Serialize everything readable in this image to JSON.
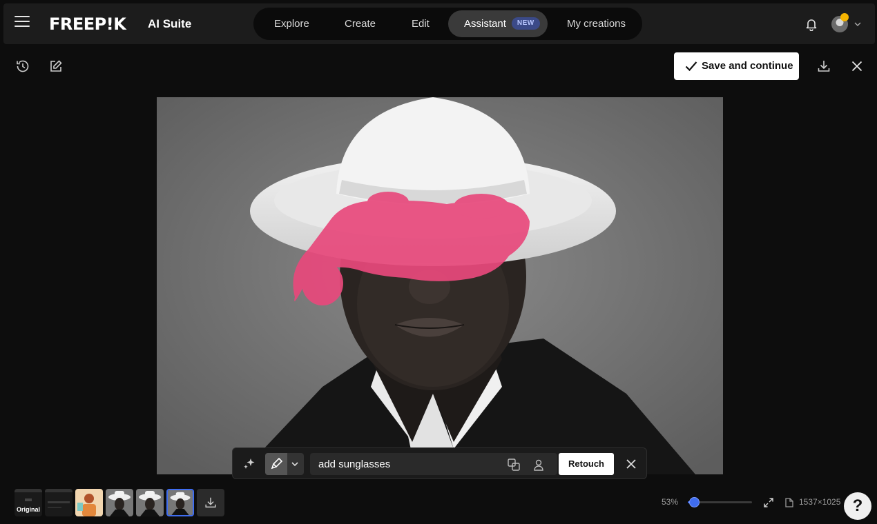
{
  "header": {
    "logo": "FREEP!K",
    "suite": "AI Suite",
    "nav": [
      {
        "label": "Explore"
      },
      {
        "label": "Create"
      },
      {
        "label": "Edit"
      },
      {
        "label": "Assistant",
        "badge": "NEW"
      },
      {
        "label": "My creations"
      }
    ],
    "active_nav": "Assistant",
    "icons": [
      "menu-icon",
      "bell-icon",
      "avatar",
      "chevron-down-icon"
    ]
  },
  "toolbar": {
    "save_label": "Save and continue",
    "icons": [
      "history-icon",
      "edit-icon",
      "download-icon",
      "close-icon"
    ]
  },
  "prompt": {
    "value": "add sunglasses",
    "placeholder": "",
    "retouch_label": "Retouch",
    "icons": [
      "sparkle-icon",
      "brush-icon",
      "chevron-down-icon",
      "translate-icon",
      "person-icon",
      "close-icon"
    ]
  },
  "thumbnails": {
    "original_label": "Original",
    "count": 6,
    "selected_index": 5
  },
  "zoom": {
    "label": "53%",
    "value": 0.1
  },
  "image": {
    "dimensions": "1537×1025"
  },
  "help": {
    "label": "?"
  },
  "colors": {
    "accent": "#3f6df0",
    "mask": "#e8497c",
    "background": "#0d0d0d"
  }
}
